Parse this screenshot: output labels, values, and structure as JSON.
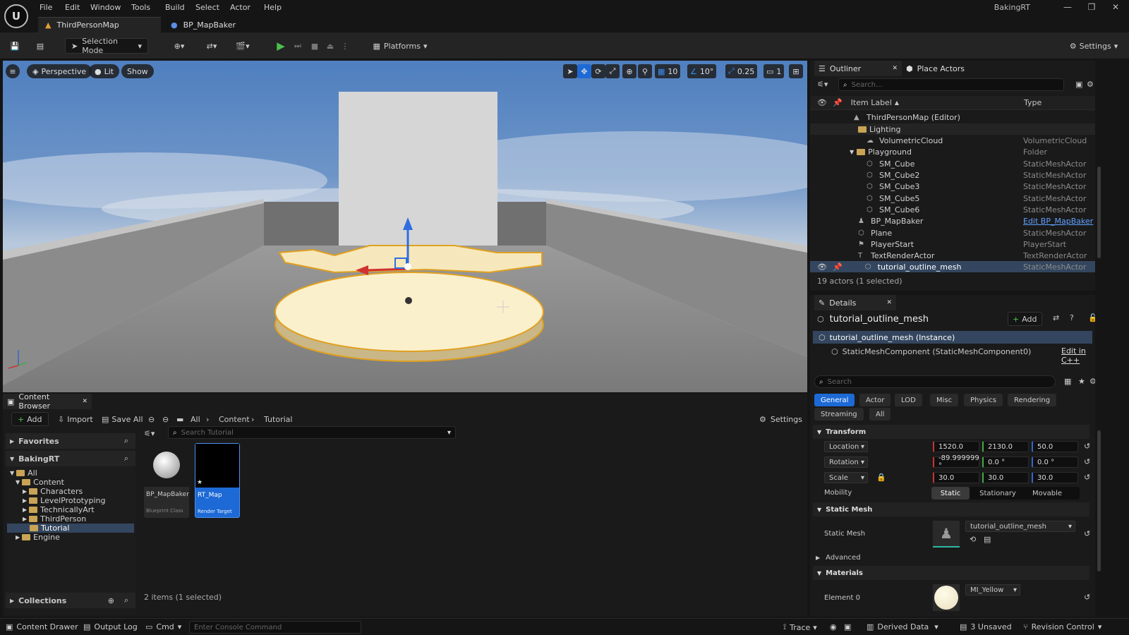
{
  "app": {
    "window_title": "BakingRT",
    "logo": "U"
  },
  "menu": [
    "File",
    "Edit",
    "Window",
    "Tools",
    "Build",
    "Select",
    "Actor",
    "Help"
  ],
  "tabs": [
    {
      "label": "ThirdPersonMap"
    },
    {
      "label": "BP_MapBaker"
    }
  ],
  "toolbar": {
    "selection_mode": "Selection Mode",
    "platforms": "Platforms",
    "settings": "Settings"
  },
  "viewport": {
    "perspective": "Perspective",
    "lit": "Lit",
    "show": "Show",
    "grid_snap": "10",
    "rot_snap": "10°",
    "scale_snap": "0.25",
    "camera_speed": "1"
  },
  "outliner": {
    "tab": "Outliner",
    "place_actors": "Place Actors",
    "search_placeholder": "Search...",
    "col_label": "Item Label",
    "col_type": "Type",
    "rows": [
      {
        "label": "ThirdPersonMap (Editor)",
        "type": ""
      },
      {
        "label": "Lighting",
        "type": ""
      },
      {
        "label": "VolumetricCloud",
        "type": "VolumetricCloud"
      },
      {
        "label": "Playground",
        "type": "Folder"
      },
      {
        "label": "SM_Cube",
        "type": "StaticMeshActor"
      },
      {
        "label": "SM_Cube2",
        "type": "StaticMeshActor"
      },
      {
        "label": "SM_Cube3",
        "type": "StaticMeshActor"
      },
      {
        "label": "SM_Cube5",
        "type": "StaticMeshActor"
      },
      {
        "label": "SM_Cube6",
        "type": "StaticMeshActor"
      },
      {
        "label": "BP_MapBaker",
        "type": "Edit BP_MapBaker"
      },
      {
        "label": "Plane",
        "type": "StaticMeshActor"
      },
      {
        "label": "PlayerStart",
        "type": "PlayerStart"
      },
      {
        "label": "TextRenderActor",
        "type": "TextRenderActor"
      },
      {
        "label": "tutorial_outline_mesh",
        "type": "StaticMeshActor"
      }
    ],
    "count": "19 actors (1 selected)"
  },
  "details": {
    "tab": "Details",
    "title": "tutorial_outline_mesh",
    "add": "Add",
    "instance": "tutorial_outline_mesh (Instance)",
    "component": "StaticMeshComponent (StaticMeshComponent0)",
    "edit_cpp": "Edit in C++",
    "search_placeholder": "Search",
    "categories": [
      "General",
      "Actor",
      "LOD",
      "Misc",
      "Physics",
      "Rendering",
      "Streaming",
      "All"
    ],
    "transform": {
      "section": "Transform",
      "location": {
        "label": "Location",
        "x": "1520.0",
        "y": "2130.0",
        "z": "50.0"
      },
      "rotation": {
        "label": "Rotation",
        "x": "-89.999999 °",
        "y": "0.0 °",
        "z": "0.0 °"
      },
      "scale": {
        "label": "Scale",
        "x": "30.0",
        "y": "30.0",
        "z": "30.0"
      },
      "mobility": {
        "label": "Mobility",
        "options": [
          "Static",
          "Stationary",
          "Movable"
        ]
      }
    },
    "static_mesh": {
      "section": "Static Mesh",
      "label": "Static Mesh",
      "value": "tutorial_outline_mesh"
    },
    "advanced": "Advanced",
    "materials": {
      "section": "Materials",
      "element": "Element 0",
      "value": "MI_Yellow"
    }
  },
  "content_browser": {
    "tab": "Content Browser",
    "add": "Add",
    "import": "Import",
    "save_all": "Save All",
    "path": [
      "All",
      "Content",
      "Tutorial"
    ],
    "settings": "Settings",
    "favorites": "Favorites",
    "project": "BakingRT",
    "tree": [
      "All",
      "Content",
      "Characters",
      "LevelPrototyping",
      "TechnicallyArt",
      "ThirdPerson",
      "Tutorial",
      "Engine"
    ],
    "collections": "Collections",
    "search_placeholder": "Search Tutorial",
    "assets": [
      {
        "name": "BP_MapBaker",
        "type": "Blueprint Class"
      },
      {
        "name": "RT_Map",
        "type": "Render Target"
      }
    ],
    "status": "2 items (1 selected)"
  },
  "statusbar": {
    "content_drawer": "Content Drawer",
    "output_log": "Output Log",
    "cmd": "Cmd",
    "console_placeholder": "Enter Console Command",
    "trace": "Trace",
    "derived_data": "Derived Data",
    "unsaved": "3 Unsaved",
    "revision_control": "Revision Control"
  }
}
